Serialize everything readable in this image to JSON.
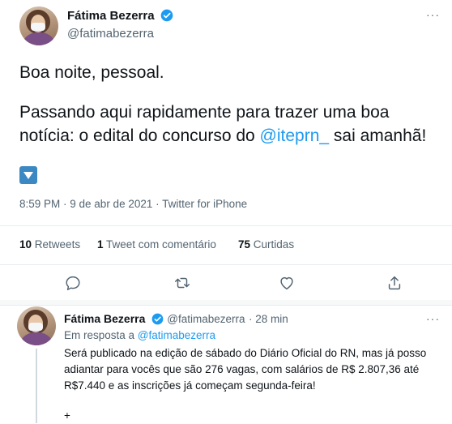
{
  "tweet": {
    "author_name": "Fátima Bezerra",
    "author_handle": "@fatimabezerra",
    "more": "···",
    "line1": "Boa noite, pessoal.",
    "line2_part1": "Passando aqui rapidamente para trazer uma boa",
    "line3_part1": "notícia: o edital do concurso do ",
    "line3_mention": "@iteprn_",
    "line3_part2": " sai amanhã!",
    "timestamp": "8:59 PM · 9 de abr de 2021 · Twitter for iPhone"
  },
  "stats": {
    "retweets_count": "10",
    "retweets_label": "Retweets",
    "comments_count": "1",
    "comments_label": "Tweet com comentário",
    "likes_count": "75",
    "likes_label": "Curtidas"
  },
  "actions": {
    "icons": [
      "reply-icon",
      "retweet-icon",
      "like-icon",
      "share-icon"
    ]
  },
  "reply": {
    "author_name": "Fátima Bezerra",
    "author_handle": "@fatimabezerra",
    "time": "· 28 min",
    "more": "···",
    "in_reply_prefix": "Em resposta a ",
    "in_reply_handle": "@fatimabezerra",
    "line1": "Será publicado na edição de sábado do Diário Oficial do RN, mas já posso",
    "line2": "adiantar para vocês que são 276 vagas, com salários de R$ 2.807,36 até",
    "line3": "R$7.440 e as inscrições já começam segunda-feira!",
    "plus": "+"
  },
  "colors": {
    "accent": "#1d9bf0",
    "text": "#0f1419",
    "muted": "#536471",
    "divider": "#e6ecf0"
  }
}
